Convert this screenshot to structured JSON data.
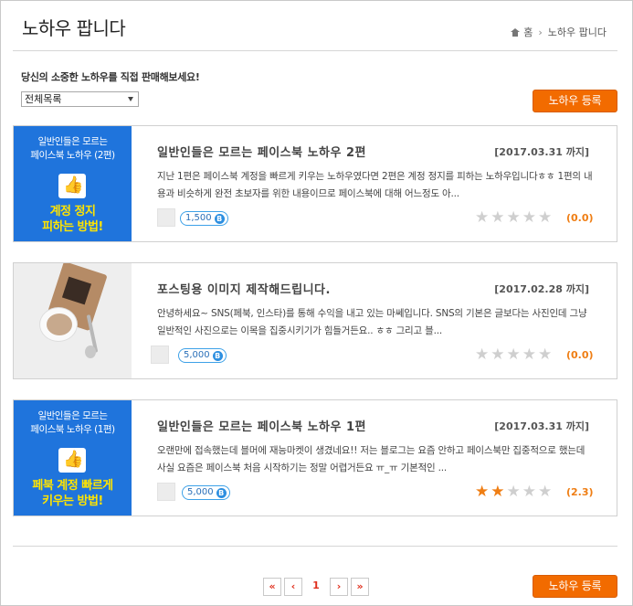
{
  "header": {
    "title": "노하우 팝니다",
    "breadcrumb_home": "홈",
    "breadcrumb_current": "노하우 팝니다"
  },
  "intro": "당신의 소중한 노하우를 직접 판매해보세요!",
  "filter": {
    "selected": "전체목록"
  },
  "register_label": "노하우 등록",
  "cards": [
    {
      "thumb": {
        "line1": "일반인들은 모르는",
        "line2": "페이스북 노하우 (2편)",
        "line3": "계정 정지",
        "line4": "피하는 방법!"
      },
      "title": "일반인들은 모르는 페이스북 노하우 2편",
      "date": "[2017.03.31 까지]",
      "desc": "지난 1편은 페이스북 계정을 빠르게 키우는 노하우였다면 2편은 계정 정지를 피하는 노하우입니다ㅎㅎ 1편의 내용과 비슷하게 완전 초보자를 위한 내용이므로 페이스북에 대해 어느정도 아...",
      "price": "1,500",
      "rating": "(0.0)",
      "stars": 0
    },
    {
      "title": "포스팅용 이미지 제작해드립니다.",
      "date": "[2017.02.28 까지]",
      "desc": "안녕하세요~ SNS(페북, 인스타)를 통해 수익을 내고 있는 마쎄입니다. SNS의 기본은 글보다는 사진인데 그냥 일반적인 사진으로는 이목을 집중시키기가 힘들거든요.. ㅎㅎ 그리고 블...",
      "price": "5,000",
      "rating": "(0.0)",
      "stars": 0
    },
    {
      "thumb": {
        "line1": "일반인들은 모르는",
        "line2": "페이스북 노하우 (1편)",
        "line3": "페북 계정 빠르게",
        "line4": "키우는 방법!"
      },
      "title": "일반인들은 모르는 페이스북 노하우 1편",
      "date": "[2017.03.31 까지]",
      "desc": "오랜만에 접속했는데 블머에 재능마켓이 생겼네요!! 저는 블로그는 요즘 안하고 페이스북만 집중적으로 했는데 사실 요즘은 페이스북 처음 시작하기는 정말 어렵거든요 ㅠ_ㅠ 기본적인 ...",
      "price": "5,000",
      "rating": "(2.3)",
      "stars": 2.3
    }
  ],
  "pagination": {
    "first": "«",
    "prev": "‹",
    "page": "1",
    "next": "›",
    "last": "»"
  },
  "icons": {
    "coin": "B",
    "like": "👍"
  },
  "colors": {
    "accent": "#f26b00",
    "thumb_blue": "#1f74dc",
    "thumb_yellow": "#ffe400",
    "star_on": "#ef7e14"
  }
}
